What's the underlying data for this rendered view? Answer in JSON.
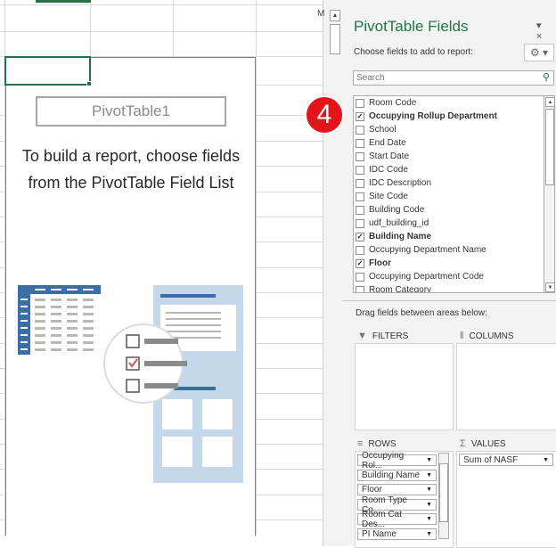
{
  "spreadsheet": {
    "pivot_name": "PivotTable1",
    "instructions": "To build a report, choose fields from the PivotTable Field List",
    "column_fragment": "M"
  },
  "pane": {
    "title": "PivotTable Fields",
    "controls": "▾ ×",
    "choose_label": "Choose fields to add to report:",
    "gear": "⚙ ▾",
    "search_placeholder": "Search",
    "step_badge": "4",
    "fields": [
      {
        "label": "Room Code",
        "checked": false,
        "bold": false
      },
      {
        "label": "Occupying Rollup Department",
        "checked": true,
        "bold": true
      },
      {
        "label": "School",
        "checked": false,
        "bold": false
      },
      {
        "label": "End Date",
        "checked": false,
        "bold": false
      },
      {
        "label": "Start Date",
        "checked": false,
        "bold": false
      },
      {
        "label": "IDC Code",
        "checked": false,
        "bold": false
      },
      {
        "label": "IDC Description",
        "checked": false,
        "bold": false
      },
      {
        "label": "Site Code",
        "checked": false,
        "bold": false
      },
      {
        "label": "Building Code",
        "checked": false,
        "bold": false
      },
      {
        "label": "udf_building_id",
        "checked": false,
        "bold": false
      },
      {
        "label": "Building Name",
        "checked": true,
        "bold": true
      },
      {
        "label": "Occupying Department Name",
        "checked": false,
        "bold": false
      },
      {
        "label": "Floor",
        "checked": true,
        "bold": true
      },
      {
        "label": "Occupying Department Code",
        "checked": false,
        "bold": false
      },
      {
        "label": "Room Category",
        "checked": false,
        "bold": false
      }
    ],
    "drag_label": "Drag fields between areas below:",
    "areas": {
      "filters": {
        "label": "FILTERS",
        "icon": "▼"
      },
      "columns": {
        "label": "COLUMNS",
        "icon": "‖"
      },
      "rows": {
        "label": "ROWS",
        "icon": "≡"
      },
      "values": {
        "label": "VALUES",
        "icon": "Σ"
      }
    },
    "rows_fields": [
      "Occupying Rol...",
      "Building Name",
      "Floor",
      "Room Type Co...",
      "Room Cat Des...",
      "PI Name"
    ],
    "values_fields": [
      "Sum of NASF"
    ]
  },
  "colors": {
    "accent": "#217346",
    "badge": "#e3151b",
    "illustration": "#3a6ea5"
  }
}
